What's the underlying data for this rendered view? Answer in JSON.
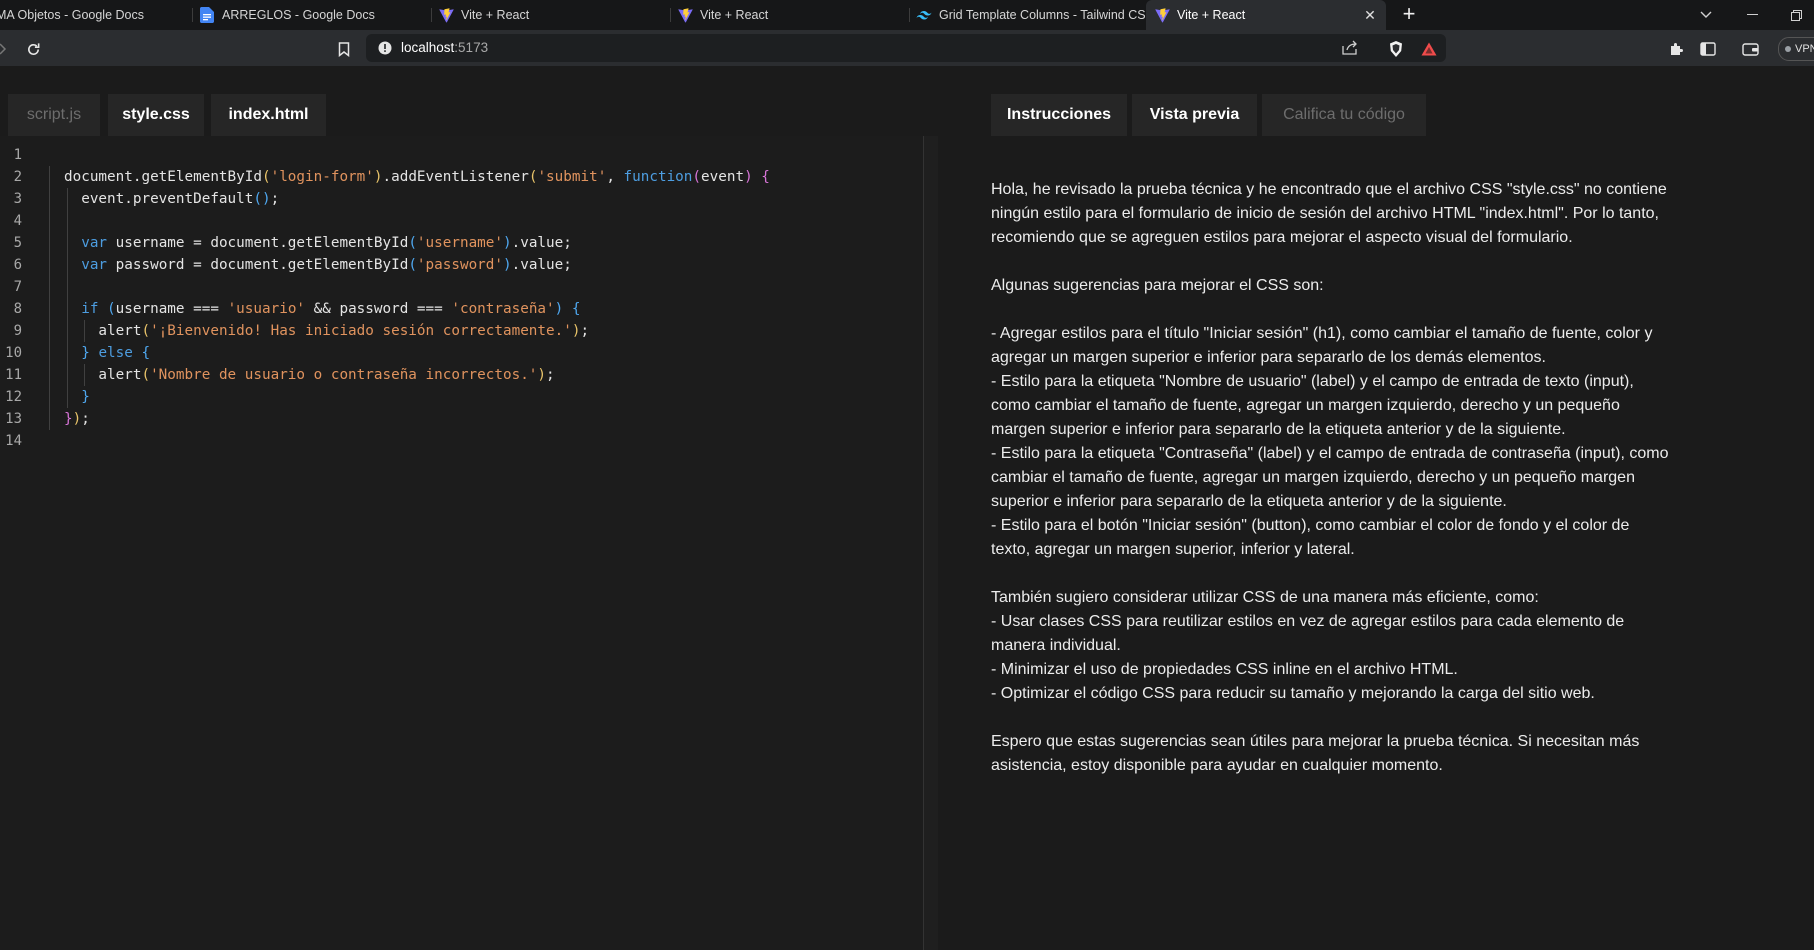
{
  "browser": {
    "tabs": [
      {
        "title": "MA Objetos - Google Docs",
        "icon": "google-docs-icon"
      },
      {
        "title": "ARREGLOS - Google Docs",
        "icon": "google-docs-icon"
      },
      {
        "title": "Vite + React",
        "icon": "vite-icon"
      },
      {
        "title": "Vite + React",
        "icon": "vite-icon"
      },
      {
        "title": "Grid Template Columns - Tailwind CSS",
        "icon": "tailwind-icon"
      },
      {
        "title": "Vite + React",
        "icon": "vite-icon",
        "active": true
      }
    ],
    "new_tab": "+",
    "address": {
      "host": "localhost",
      "port": ":5173"
    },
    "vpn_label": "VPN"
  },
  "editor": {
    "file_tabs": [
      {
        "label": "script.js",
        "active": false
      },
      {
        "label": "style.css",
        "active": true
      },
      {
        "label": "index.html",
        "active": true
      }
    ],
    "line_numbers": [
      "1",
      "2",
      "3",
      "4",
      "5",
      "6",
      "7",
      "8",
      "9",
      "10",
      "11",
      "12",
      "13",
      "14"
    ],
    "lines": [
      "",
      "document.getElementById('login-form').addEventListener('submit', function(event) {",
      "  event.preventDefault();",
      "",
      "  var username = document.getElementById('username').value;",
      "  var password = document.getElementById('password').value;",
      "",
      "  if (username === 'usuario' && password === 'contraseña') {",
      "    alert('¡Bienvenido! Has iniciado sesión correctamente.');",
      "  } else {",
      "    alert('Nombre de usuario o contraseña incorrectos.');",
      "  }",
      "});",
      ""
    ]
  },
  "panel": {
    "tabs": [
      {
        "label": "Instrucciones",
        "active": true
      },
      {
        "label": "Vista previa",
        "active": true
      },
      {
        "label": "Califica tu código",
        "active": false
      }
    ],
    "paragraphs": [
      [
        "Hola, he revisado la prueba técnica y he encontrado que el archivo CSS \"style.css\" no contiene ningún estilo para el formulario de inicio de sesión del archivo HTML \"index.html\". Por lo tanto, recomiendo que se agreguen estilos para mejorar el aspecto visual del formulario."
      ],
      [
        "Algunas sugerencias para mejorar el CSS son:"
      ],
      [
        "- Agregar estilos para el título \"Iniciar sesión\" (h1), como cambiar el tamaño de fuente, color y agregar un margen superior e inferior para separarlo de los demás elementos.",
        "- Estilo para la etiqueta \"Nombre de usuario\" (label) y el campo de entrada de texto (input), como cambiar el tamaño de fuente, agregar un margen izquierdo, derecho y un pequeño margen superior e inferior para separarlo de la etiqueta anterior y de la siguiente.",
        "- Estilo para la etiqueta \"Contraseña\" (label) y el campo de entrada de contraseña (input), como cambiar el tamaño de fuente, agregar un margen izquierdo, derecho y un pequeño margen superior e inferior para separarlo de la etiqueta anterior y de la siguiente.",
        "- Estilo para el botón \"Iniciar sesión\" (button), como cambiar el color de fondo y el color de texto, agregar un margen superior, inferior y lateral."
      ],
      [
        "También sugiero considerar utilizar CSS de una manera más eficiente, como:",
        "- Usar clases CSS para reutilizar estilos en vez de agregar estilos para cada elemento de manera individual.",
        "- Minimizar el uso de propiedades CSS inline en el archivo HTML.",
        "- Optimizar el código CSS para reducir su tamaño y mejorando la carga del sitio web."
      ],
      [
        "Espero que estas sugerencias sean útiles para mejorar la prueba técnica. Si necesitan más asistencia, estoy disponible para ayudar en cualquier momento."
      ]
    ]
  },
  "colors": {
    "string": "#e0935e",
    "keyword": "#4d9de0",
    "bracket_level1": "#e9c46a",
    "bracket_level2": "#d774d7",
    "bracket_level3": "#4fa8f0"
  }
}
